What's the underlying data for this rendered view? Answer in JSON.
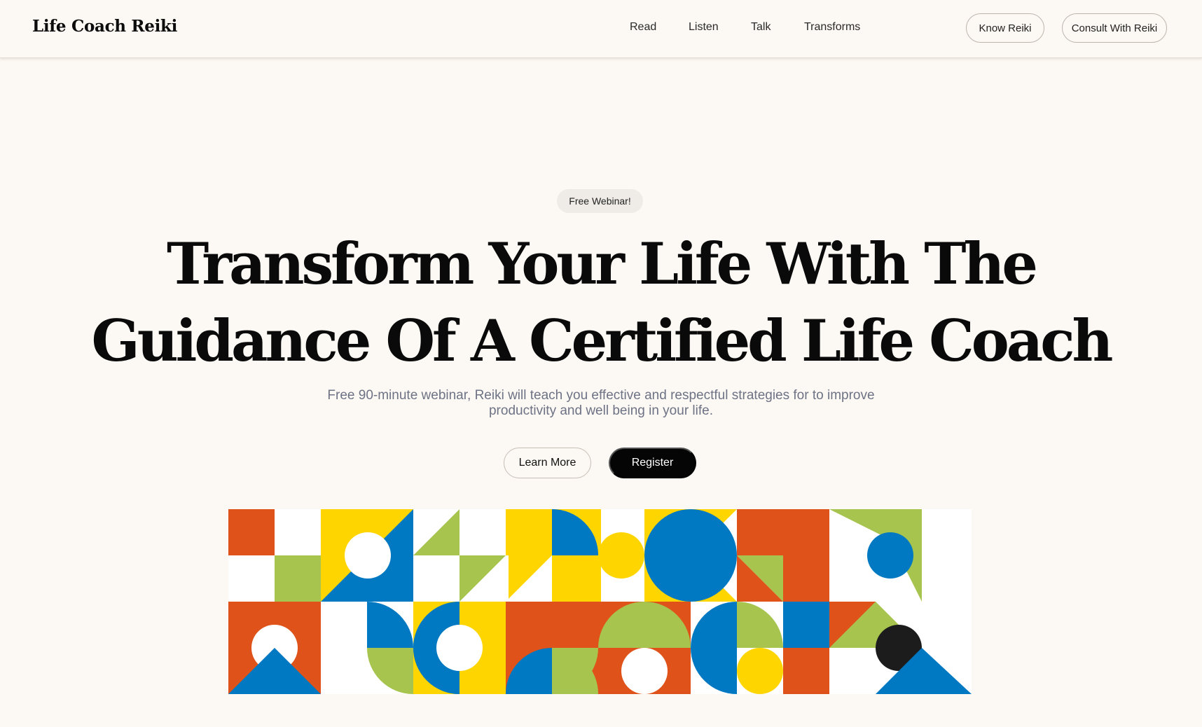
{
  "header": {
    "logo": "Life Coach Reiki",
    "nav": [
      "Read",
      "Listen",
      "Talk",
      "Transforms"
    ],
    "buttons": [
      "Know Reiki",
      "Consult With Reiki"
    ]
  },
  "hero": {
    "badge": "Free Webinar!",
    "headline_line1": "Transform Your Life With The",
    "headline_line2": "Guidance Of A Certified Life Coach",
    "subtitle": "Free 90-minute webinar, Reiki will teach you effective and respectful strategies for to improve productivity and well being in your life.",
    "learn_more": "Learn More",
    "register": "Register"
  },
  "colors": {
    "background": "#fcf8f3",
    "orange": "#df5219",
    "yellow": "#ffd500",
    "blue": "#0079c2",
    "green": "#a6c44e",
    "white": "#ffffff",
    "black": "#1c1c1c"
  }
}
